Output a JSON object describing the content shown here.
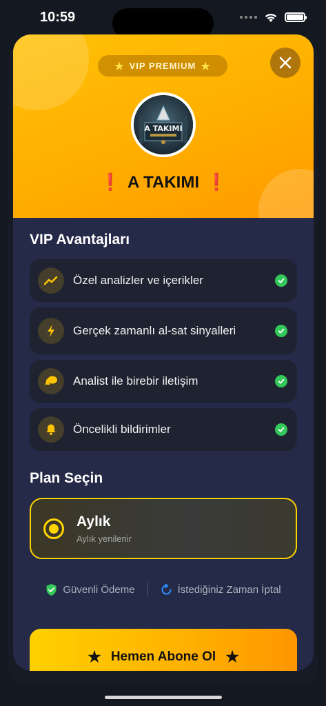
{
  "status_bar": {
    "time": "10:59"
  },
  "header": {
    "badge_label": "VIP PREMIUM",
    "badge_star": "★",
    "brand_name": "A TAKIMI",
    "exclamation": "❗",
    "logo_text": "A TAKIMI"
  },
  "benefits": {
    "title": "VIP Avantajları",
    "items": [
      {
        "label": "Özel analizler ve içerikler",
        "icon": "trend-icon"
      },
      {
        "label": "Gerçek zamanlı al-sat sinyalleri",
        "icon": "lightning-icon"
      },
      {
        "label": "Analist ile birebir iletişim",
        "icon": "chat-icon"
      },
      {
        "label": "Öncelikli bildirimler",
        "icon": "bell-icon"
      }
    ]
  },
  "plans": {
    "title": "Plan Seçin",
    "selected": {
      "name": "Aylık",
      "subtitle": "Aylık yenilenir"
    }
  },
  "trust": {
    "secure_payment": "Güvenli Ödeme",
    "cancel_anytime": "İstediğiniz Zaman İptal"
  },
  "cta": {
    "label": "Hemen Abone Ol",
    "star": "★"
  },
  "colors": {
    "accent": "#FFC107",
    "sheet_bg": "#242A47",
    "card_bg": "#1F2231",
    "check_green": "#34C759",
    "plan_border": "#FFD400"
  }
}
